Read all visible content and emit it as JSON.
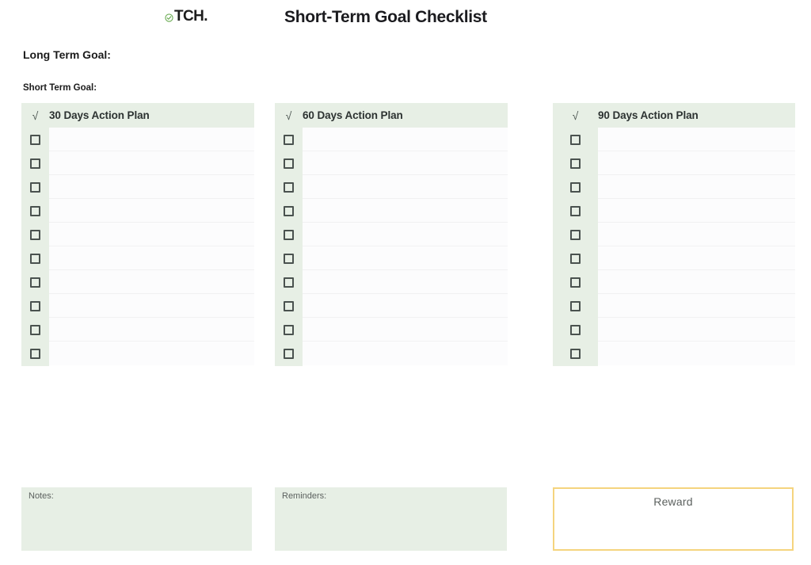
{
  "header": {
    "logo_text": "TCH.",
    "logo_icon": "check-circle-icon",
    "logo_icon_color": "#6aab52",
    "title": "Short-Term Goal Checklist"
  },
  "goals": {
    "long_term_label": "Long Term Goal:",
    "long_term_value": "",
    "short_term_label": "Short Term Goal:",
    "short_term_value": ""
  },
  "columns": [
    {
      "check_glyph": "√",
      "title": "30 Days Action Plan",
      "rows": [
        "",
        "",
        "",
        "",
        "",
        "",
        "",
        "",
        "",
        ""
      ]
    },
    {
      "check_glyph": "√",
      "title": "60 Days Action Plan",
      "rows": [
        "",
        "",
        "",
        "",
        "",
        "",
        "",
        "",
        "",
        ""
      ]
    },
    {
      "check_glyph": "√",
      "title": "90 Days Action Plan",
      "rows": [
        "",
        "",
        "",
        "",
        "",
        "",
        "",
        "",
        "",
        ""
      ]
    }
  ],
  "bottom": {
    "notes_label": "Notes:",
    "notes_value": "",
    "reminders_label": "Reminders:",
    "reminders_value": "",
    "reward_label": "Reward",
    "reward_value": ""
  },
  "colors": {
    "panel_green": "#e7efe5",
    "row_bg": "#fcfcfd",
    "row_rule": "#f1f1f2",
    "checkbox_stroke": "#4a524f",
    "reward_border": "#f5d47e",
    "text_dark": "#1b1b1b",
    "text_muted": "#5c615f"
  }
}
